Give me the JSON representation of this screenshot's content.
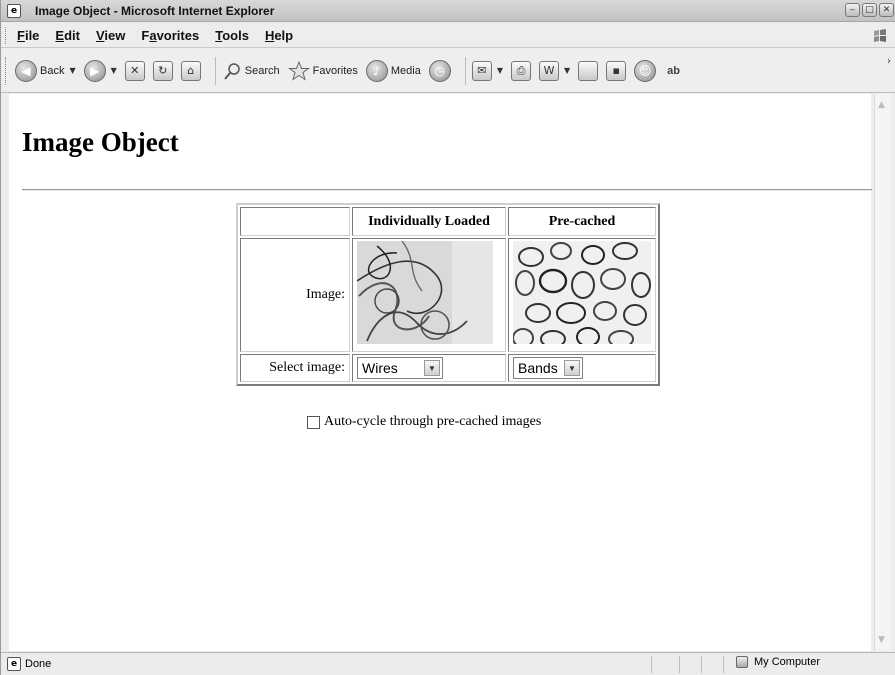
{
  "window": {
    "title": "Image Object - Microsoft Internet Explorer",
    "controls": [
      "minimize-icon",
      "maximize-icon",
      "close-icon"
    ]
  },
  "menu": {
    "items": [
      {
        "label": "File",
        "accel": "F"
      },
      {
        "label": "Edit",
        "accel": "E"
      },
      {
        "label": "View",
        "accel": "V"
      },
      {
        "label": "Favorites",
        "accel": "a"
      },
      {
        "label": "Tools",
        "accel": "T"
      },
      {
        "label": "Help",
        "accel": "H"
      }
    ]
  },
  "toolbar": {
    "back_label": "Back",
    "search_label": "Search",
    "favorites_label": "Favorites",
    "media_label": "Media"
  },
  "page": {
    "title": "Image Object",
    "table": {
      "col_headers": [
        "Individually Loaded",
        "Pre-cached"
      ],
      "image_row_label": "Image:",
      "select_row_label": "Select image:",
      "individual_select_value": "Wires",
      "precached_select_value": "Bands",
      "individual_image": "wires-image",
      "precached_image": "bands-image"
    },
    "auto_cycle_label": "Auto-cycle through pre-cached images",
    "auto_cycle_checked": false
  },
  "status": {
    "text": "Done",
    "zone": "My Computer"
  }
}
